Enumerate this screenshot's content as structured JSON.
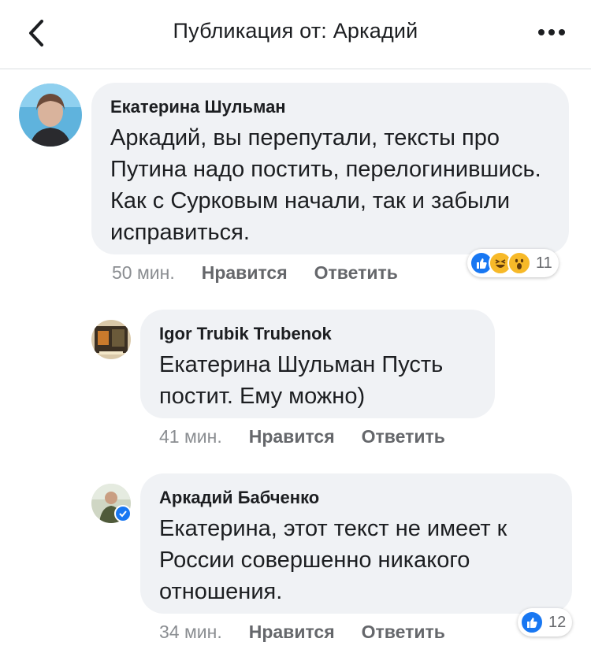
{
  "header": {
    "title": "Публикация от: Аркадий"
  },
  "comments": [
    {
      "author": "Екатерина Шульман",
      "text": "Аркадий, вы перепутали, тексты про Путина надо постить, перелогинившись. Как с Сурковым начали, так и забыли исправиться.",
      "time": "50 мин.",
      "like_label": "Нравится",
      "reply_label": "Ответить",
      "reaction_count": "11"
    },
    {
      "author": "Igor Trubik Trubenok",
      "text": "Екатерина Шульман Пусть постит.  Ему можно)",
      "time": "41 мин.",
      "like_label": "Нравится",
      "reply_label": "Ответить"
    },
    {
      "author": "Аркадий Бабченко",
      "text": "Екатерина, этот текст не имеет к России совершенно никакого отношения.",
      "time": "34 мин.",
      "like_label": "Нравится",
      "reply_label": "Ответить",
      "reaction_count": "12"
    }
  ],
  "colors": {
    "like_blue": "#1877f2",
    "haha_yellow": "#f7b928",
    "bubble_bg": "#f0f2f5"
  },
  "icons": {
    "back": "chevron-left-icon",
    "more": "more-dots-icon",
    "like": "like-reaction-icon",
    "haha": "haha-reaction-icon",
    "wow": "wow-reaction-icon",
    "verified": "verified-check-icon"
  }
}
